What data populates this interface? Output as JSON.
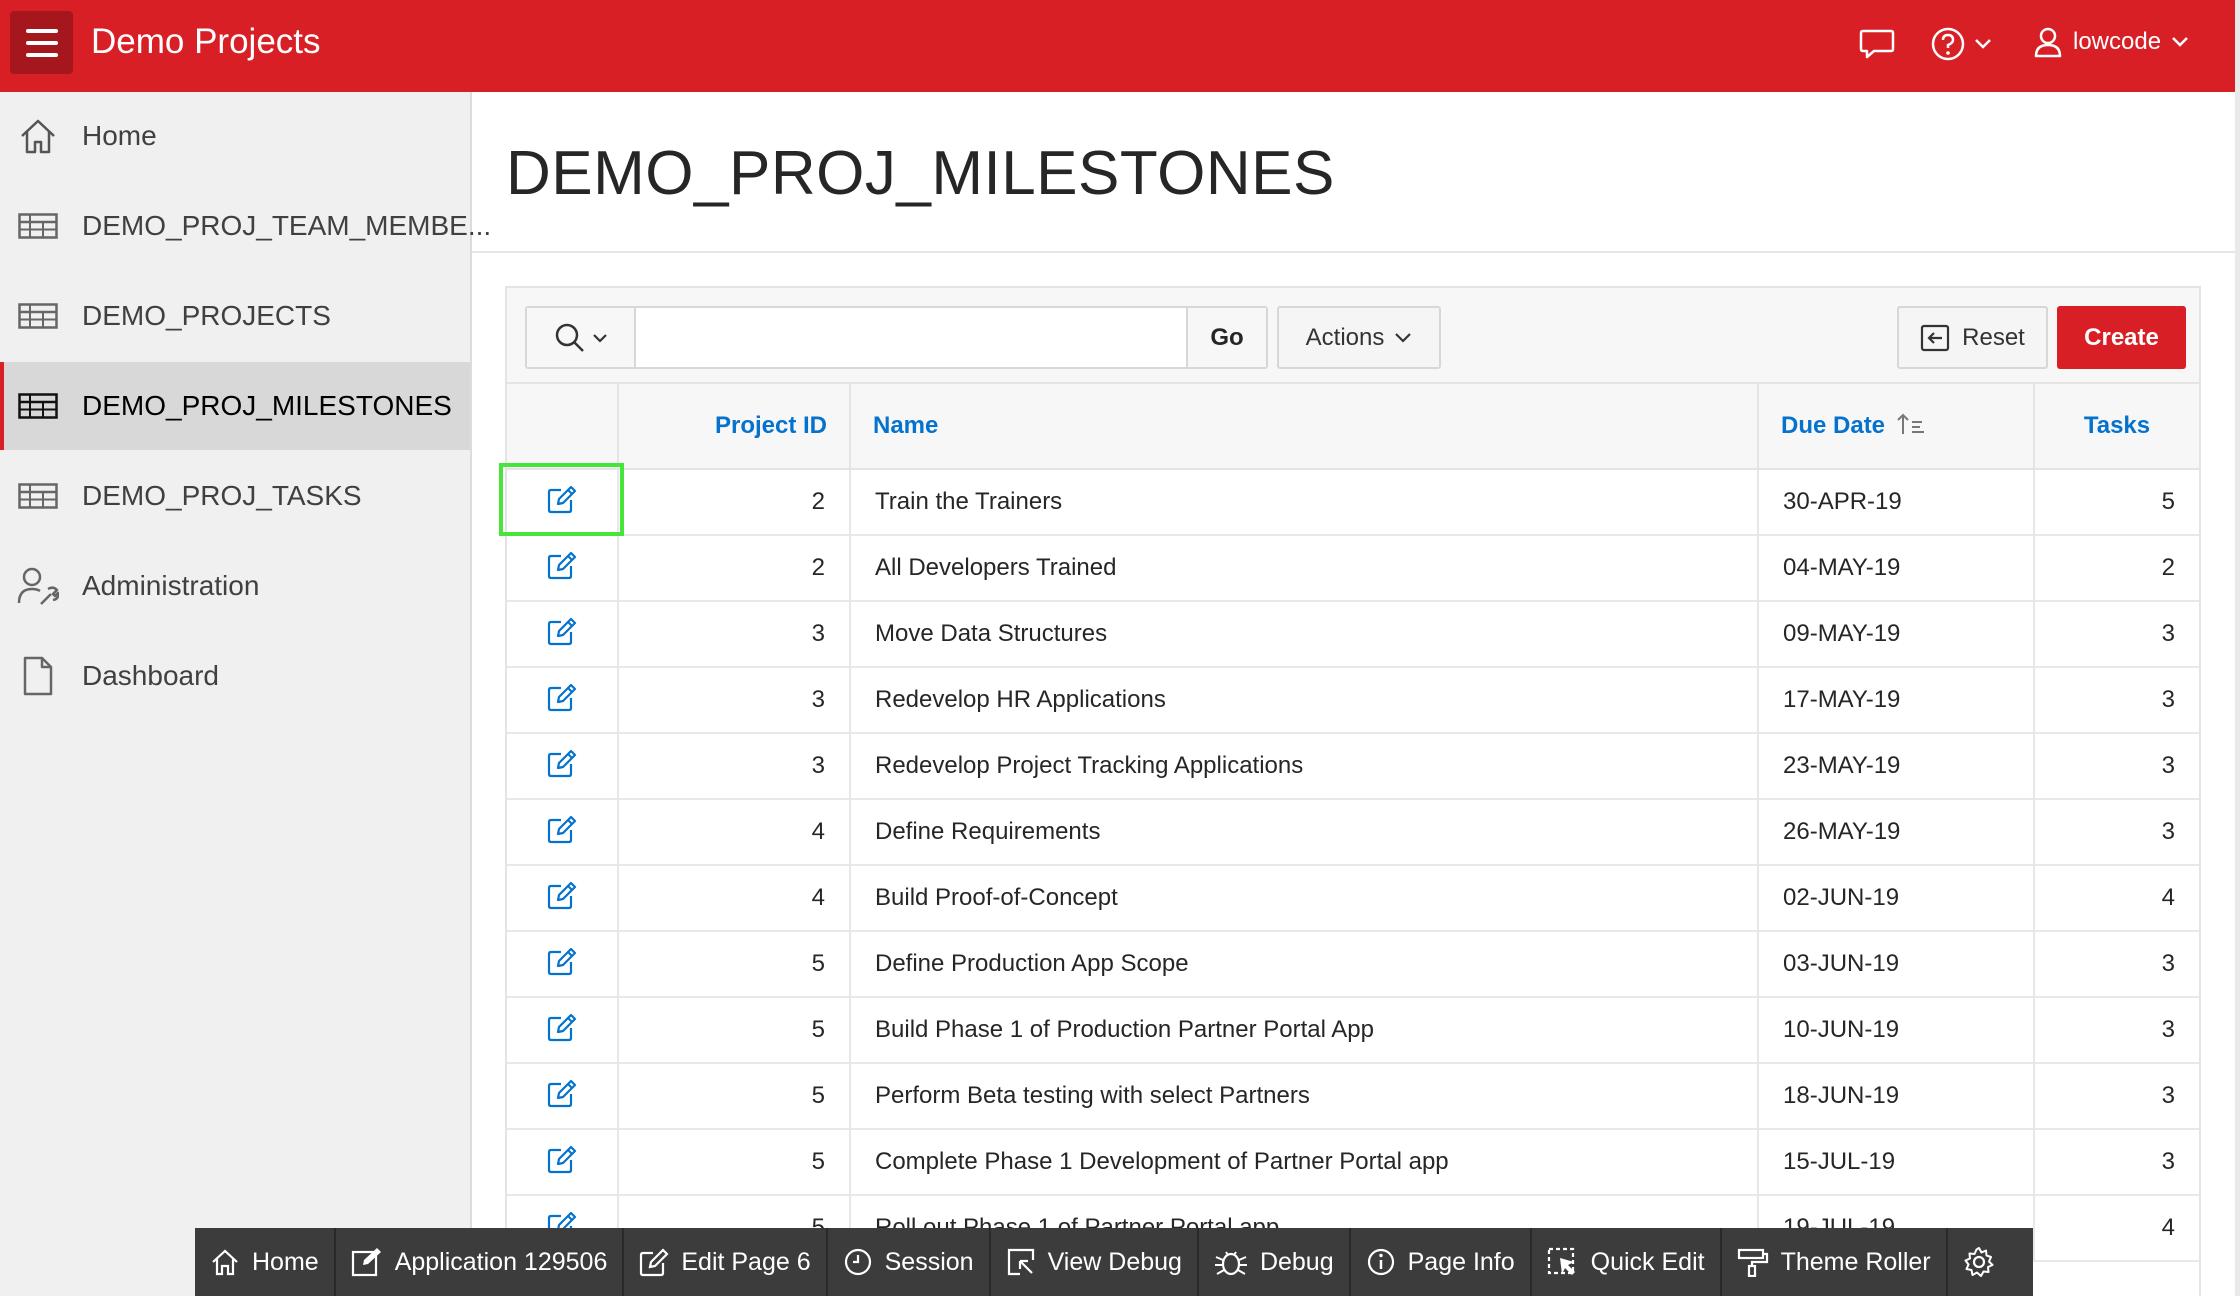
{
  "header": {
    "app_title": "Demo Projects",
    "user_name": "lowcode",
    "brand_color": "#d91f26"
  },
  "sidebar": {
    "items": [
      {
        "label": "Home",
        "icon": "home-icon"
      },
      {
        "label": "DEMO_PROJ_TEAM_MEMBE...",
        "icon": "table-icon"
      },
      {
        "label": "DEMO_PROJECTS",
        "icon": "table-icon"
      },
      {
        "label": "DEMO_PROJ_MILESTONES",
        "icon": "table-icon",
        "active": true
      },
      {
        "label": "DEMO_PROJ_TASKS",
        "icon": "table-icon"
      },
      {
        "label": "Administration",
        "icon": "user-wrench-icon"
      },
      {
        "label": "Dashboard",
        "icon": "file-icon"
      }
    ]
  },
  "page": {
    "title": "DEMO_PROJ_MILESTONES"
  },
  "toolbar": {
    "search_value": "",
    "go_label": "Go",
    "actions_label": "Actions",
    "reset_label": "Reset",
    "create_label": "Create"
  },
  "grid": {
    "columns": [
      "",
      "Project ID",
      "Name",
      "Due Date",
      "Tasks"
    ],
    "sorted_column": "Due Date",
    "sort_direction": "ascending",
    "rows": [
      {
        "project_id": "2",
        "name": "Train the Trainers",
        "due_date": "30-APR-19",
        "tasks": "5"
      },
      {
        "project_id": "2",
        "name": "All Developers Trained",
        "due_date": "04-MAY-19",
        "tasks": "2"
      },
      {
        "project_id": "3",
        "name": "Move Data Structures",
        "due_date": "09-MAY-19",
        "tasks": "3"
      },
      {
        "project_id": "3",
        "name": "Redevelop HR Applications",
        "due_date": "17-MAY-19",
        "tasks": "3"
      },
      {
        "project_id": "3",
        "name": "Redevelop Project Tracking Applications",
        "due_date": "23-MAY-19",
        "tasks": "3"
      },
      {
        "project_id": "4",
        "name": "Define Requirements",
        "due_date": "26-MAY-19",
        "tasks": "3"
      },
      {
        "project_id": "4",
        "name": "Build Proof-of-Concept",
        "due_date": "02-JUN-19",
        "tasks": "4"
      },
      {
        "project_id": "5",
        "name": "Define Production App Scope",
        "due_date": "03-JUN-19",
        "tasks": "3"
      },
      {
        "project_id": "5",
        "name": "Build Phase 1 of Production Partner Portal App",
        "due_date": "10-JUN-19",
        "tasks": "3"
      },
      {
        "project_id": "5",
        "name": "Perform Beta testing with select Partners",
        "due_date": "18-JUN-19",
        "tasks": "3"
      },
      {
        "project_id": "5",
        "name": "Complete Phase 1 Development of Partner Portal app",
        "due_date": "15-JUL-19",
        "tasks": "3"
      },
      {
        "project_id": "5",
        "name": "Roll out Phase 1 of Partner Portal app",
        "due_date": "19-JUL-19",
        "tasks": "4"
      }
    ]
  },
  "dev_toolbar": {
    "items": [
      {
        "label": "Home",
        "icon": "home-icon"
      },
      {
        "label": "Application 129506",
        "icon": "edit-square-icon"
      },
      {
        "label": "Edit Page 6",
        "icon": "pencil-square-icon"
      },
      {
        "label": "Session",
        "icon": "clock-icon"
      },
      {
        "label": "View Debug",
        "icon": "view-debug-icon"
      },
      {
        "label": "Debug",
        "icon": "bug-icon"
      },
      {
        "label": "Page Info",
        "icon": "info-icon"
      },
      {
        "label": "Quick Edit",
        "icon": "quick-edit-icon"
      },
      {
        "label": "Theme Roller",
        "icon": "paint-roller-icon"
      },
      {
        "label": "",
        "icon": "gear-icon"
      }
    ]
  }
}
